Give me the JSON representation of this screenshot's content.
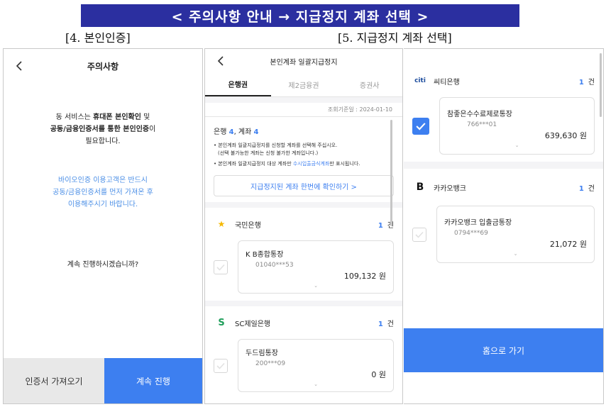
{
  "banner": "< 주의사항 안내 → 지급정지 계좌 선택 >",
  "captions": {
    "left": "[4. 본인인증]",
    "right": "[5. 지급정지 계좌 선택]"
  },
  "panel1": {
    "title": "주의사항",
    "lines": [
      [
        "동 서비스는 ",
        "휴대폰 본인확인",
        " 및"
      ],
      [
        "공동/금융인증서를 통한 본인인증",
        "이"
      ],
      [
        "필요합니다."
      ]
    ],
    "bio_note": [
      "바이오인증 이용고객은 반드시",
      "공동/금융인증서를 먼저 가져온 후",
      "이용해주시기 바랍니다."
    ],
    "question": "계속 진행하시겠습니까?",
    "btn_import": "인증서 가져오기",
    "btn_continue": "계속 진행"
  },
  "panel2": {
    "title": "본인계좌 일괄지급정지",
    "tabs": [
      "은행권",
      "제2금융권",
      "증권사"
    ],
    "date": "조회기준일 : 2024-01-10",
    "summary": {
      "bank_label": "은행",
      "bank_count": "4",
      "acct_label": "계좌",
      "acct_count": "4"
    },
    "note1": "• 본인계좌 일괄지급정지를 신청할 계좌를 선택해 주십시오.",
    "note1b": "(선택 불가능한 계좌는 신청 불가한 계좌입니다.)",
    "note2a": "• 본인계좌 일괄지급정지 대상 계좌만 ",
    "note2b": "수시입출금식계좌",
    "note2c": "만 표시됩니다.",
    "confirm": "지급정지된 계좌 한번에 확인하기  >",
    "unit_count": "건",
    "banks": [
      {
        "name": "국민은행",
        "count": "1",
        "acct_name": "K B종합통장",
        "acct_no": "01040***53",
        "amount": "109,132 원",
        "logo": "★",
        "checked": false
      },
      {
        "name": "SC제일은행",
        "count": "1",
        "acct_name": "두드림통장",
        "acct_no": "200***09",
        "amount": "0 원",
        "logo": "S",
        "checked": false
      }
    ]
  },
  "panel3": {
    "banks": [
      {
        "name": "씨티은행",
        "count": "1",
        "acct_name": "참좋은수수료제로통장",
        "acct_no": "766***01",
        "amount": "639,630 원",
        "logo": "citi",
        "checked": true
      },
      {
        "name": "카카오뱅크",
        "count": "1",
        "acct_name": "카카오뱅크   입출금통장",
        "acct_no": "0794***69",
        "amount": "21,072 원",
        "logo": "B",
        "checked": false
      }
    ],
    "unit_count": "건",
    "home": "홈으로 가기"
  },
  "colors": {
    "banner": "#2b2fa0",
    "accent": "#3d7ff0",
    "note": "#4a8ee6"
  }
}
